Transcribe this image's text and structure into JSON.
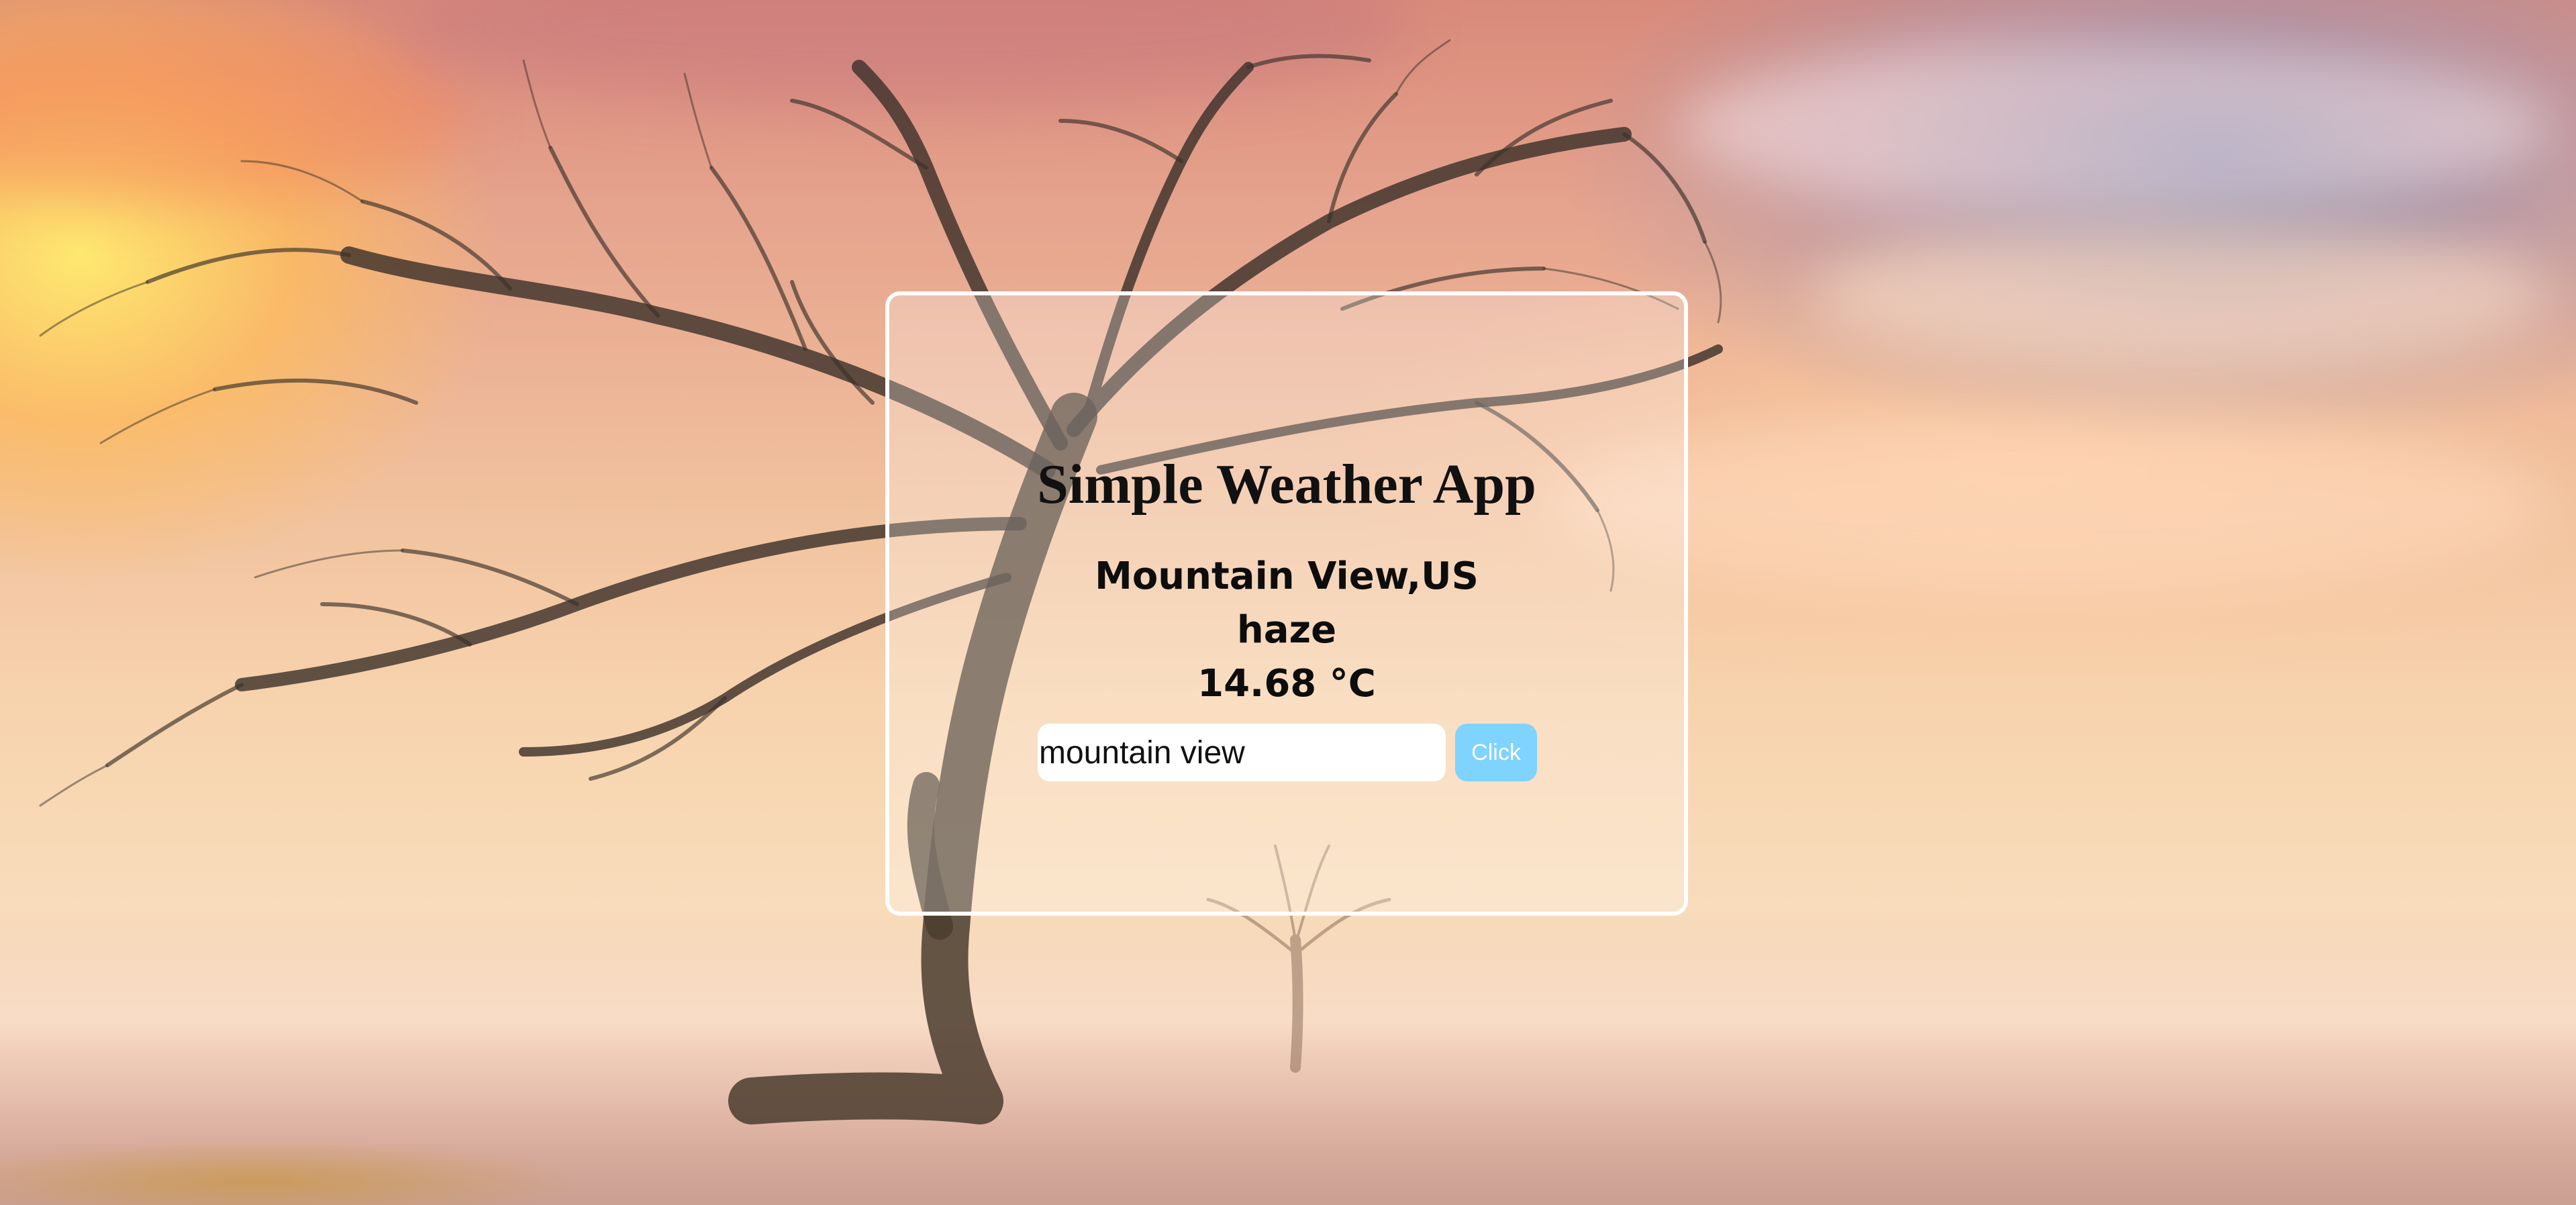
{
  "app": {
    "title": "Simple Weather App"
  },
  "weather": {
    "location": "Mountain View,US",
    "description": "haze",
    "temperature": "14.68 °C"
  },
  "search": {
    "value": "mountain view",
    "button_label": "Click"
  },
  "colors": {
    "card_border": "#ffffff",
    "button_background": "#7fd3ff",
    "button_text": "#ffffff",
    "text": "#111111"
  }
}
